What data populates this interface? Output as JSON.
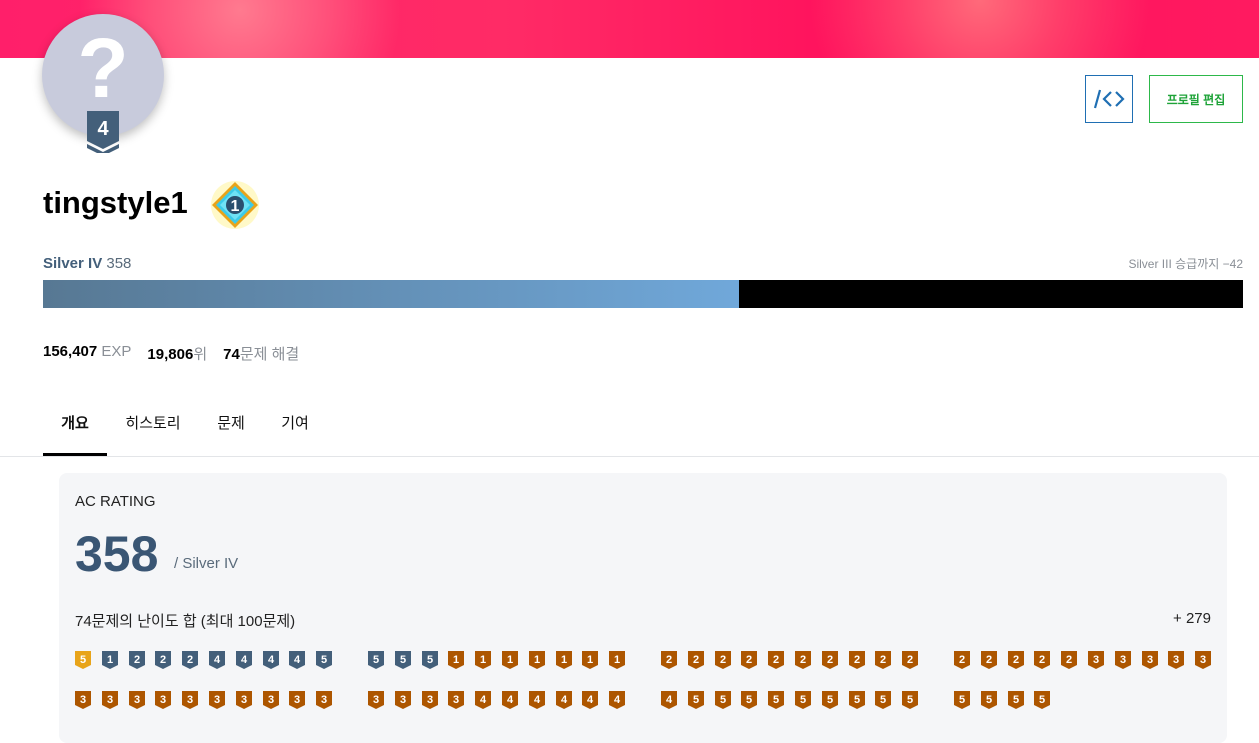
{
  "profile": {
    "avatar_glyph": "?",
    "tier_level": "4",
    "username": "tingstyle1",
    "class_level": "1",
    "tier_name": "Silver IV",
    "rating": "358",
    "promotion": "Silver III 승급까지 −42",
    "progress_fraction": 0.58
  },
  "buttons": {
    "code_label": "/<>",
    "edit_label": "프로필 편집"
  },
  "stats": {
    "exp_value": "156,407",
    "exp_label": "EXP",
    "rank_value": "19,806",
    "rank_label": "위",
    "solved_value": "74",
    "solved_label": "문제 해결"
  },
  "tabs": [
    {
      "label": "개요"
    },
    {
      "label": "히스토리"
    },
    {
      "label": "문제"
    },
    {
      "label": "기여"
    }
  ],
  "ac_rating": {
    "title": "AC RATING",
    "value": "358",
    "tier": "/ Silver IV",
    "sum_label": "74문제의 난이도 합 (최대 100문제)",
    "sum_value": "+ 279"
  },
  "colors": {
    "gold": "#e8a41a",
    "silver": "#435f7a",
    "bronze": "#ad5600"
  },
  "problem_badges": {
    "row1": [
      [
        [
          "gold",
          "5"
        ],
        [
          "silver",
          "1"
        ],
        [
          "silver",
          "2"
        ],
        [
          "silver",
          "2"
        ],
        [
          "silver",
          "2"
        ],
        [
          "silver",
          "4"
        ],
        [
          "silver",
          "4"
        ],
        [
          "silver",
          "4"
        ],
        [
          "silver",
          "4"
        ],
        [
          "silver",
          "5"
        ]
      ],
      [
        [
          "silver",
          "5"
        ],
        [
          "silver",
          "5"
        ],
        [
          "silver",
          "5"
        ],
        [
          "bronze",
          "1"
        ],
        [
          "bronze",
          "1"
        ],
        [
          "bronze",
          "1"
        ],
        [
          "bronze",
          "1"
        ],
        [
          "bronze",
          "1"
        ],
        [
          "bronze",
          "1"
        ],
        [
          "bronze",
          "1"
        ]
      ],
      [
        [
          "bronze",
          "2"
        ],
        [
          "bronze",
          "2"
        ],
        [
          "bronze",
          "2"
        ],
        [
          "bronze",
          "2"
        ],
        [
          "bronze",
          "2"
        ],
        [
          "bronze",
          "2"
        ],
        [
          "bronze",
          "2"
        ],
        [
          "bronze",
          "2"
        ],
        [
          "bronze",
          "2"
        ],
        [
          "bronze",
          "2"
        ]
      ],
      [
        [
          "bronze",
          "2"
        ],
        [
          "bronze",
          "2"
        ],
        [
          "bronze",
          "2"
        ],
        [
          "bronze",
          "2"
        ],
        [
          "bronze",
          "2"
        ],
        [
          "bronze",
          "3"
        ],
        [
          "bronze",
          "3"
        ],
        [
          "bronze",
          "3"
        ],
        [
          "bronze",
          "3"
        ],
        [
          "bronze",
          "3"
        ]
      ]
    ],
    "row2": [
      [
        [
          "bronze",
          "3"
        ],
        [
          "bronze",
          "3"
        ],
        [
          "bronze",
          "3"
        ],
        [
          "bronze",
          "3"
        ],
        [
          "bronze",
          "3"
        ],
        [
          "bronze",
          "3"
        ],
        [
          "bronze",
          "3"
        ],
        [
          "bronze",
          "3"
        ],
        [
          "bronze",
          "3"
        ],
        [
          "bronze",
          "3"
        ]
      ],
      [
        [
          "bronze",
          "3"
        ],
        [
          "bronze",
          "3"
        ],
        [
          "bronze",
          "3"
        ],
        [
          "bronze",
          "3"
        ],
        [
          "bronze",
          "4"
        ],
        [
          "bronze",
          "4"
        ],
        [
          "bronze",
          "4"
        ],
        [
          "bronze",
          "4"
        ],
        [
          "bronze",
          "4"
        ],
        [
          "bronze",
          "4"
        ]
      ],
      [
        [
          "bronze",
          "4"
        ],
        [
          "bronze",
          "5"
        ],
        [
          "bronze",
          "5"
        ],
        [
          "bronze",
          "5"
        ],
        [
          "bronze",
          "5"
        ],
        [
          "bronze",
          "5"
        ],
        [
          "bronze",
          "5"
        ],
        [
          "bronze",
          "5"
        ],
        [
          "bronze",
          "5"
        ],
        [
          "bronze",
          "5"
        ]
      ],
      [
        [
          "bronze",
          "5"
        ],
        [
          "bronze",
          "5"
        ],
        [
          "bronze",
          "5"
        ],
        [
          "bronze",
          "5"
        ]
      ]
    ]
  }
}
